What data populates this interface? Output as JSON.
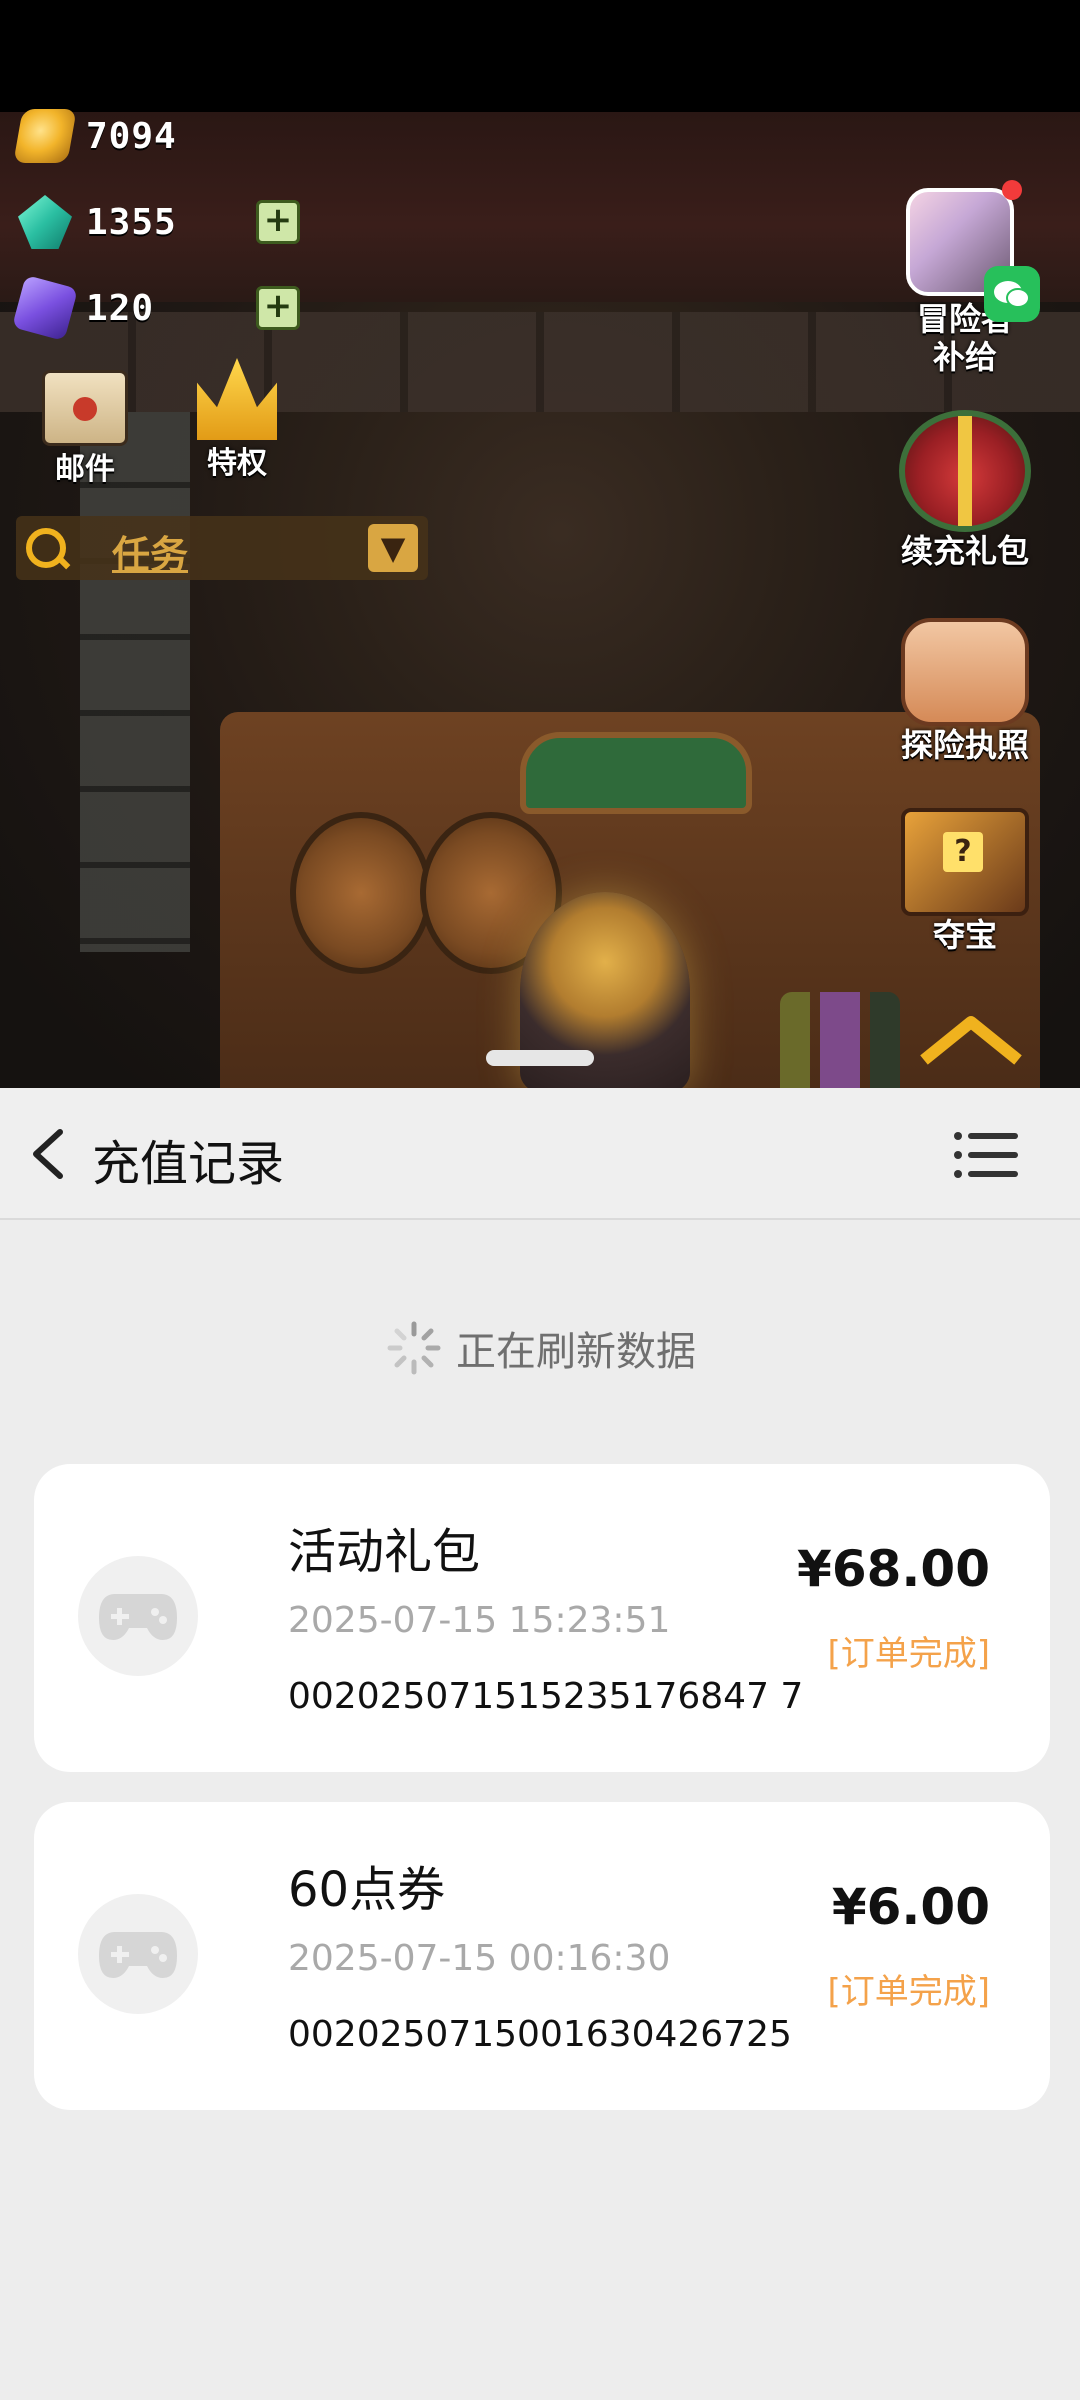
{
  "game": {
    "resources": [
      {
        "name": "gold",
        "value": "7094"
      },
      {
        "name": "diamond",
        "value": "1355"
      },
      {
        "name": "crystal",
        "value": "120"
      }
    ],
    "menu": [
      {
        "icon": "mail-icon",
        "label": "邮件"
      },
      {
        "icon": "crown-icon",
        "label": "特权"
      }
    ],
    "task_label": "任务",
    "side_buttons": [
      {
        "icon": "supply-icon",
        "label_line1": "冒险者",
        "label_line2": "补给"
      },
      {
        "icon": "gift-box-icon",
        "label": "续充礼包"
      },
      {
        "icon": "scroll-icon",
        "label": "探险执照"
      },
      {
        "icon": "treasure-icon",
        "label": "夺宝"
      }
    ]
  },
  "sheet": {
    "title": "充值记录",
    "refresh_text": "正在刷新数据",
    "records": [
      {
        "name": "活动礼包",
        "time": "2025-07-15 15:23:51",
        "order": "002025071515235176847 7",
        "price": "¥68.00",
        "status": "[订单完成]"
      },
      {
        "name": "60点券",
        "time": "2025-07-15 00:16:30",
        "order": "0020250715001630426725",
        "price": "¥6.00",
        "status": "[订单完成]"
      }
    ]
  },
  "colors": {
    "accent_orange": "#f4a24a",
    "sheet_bg": "#ededed"
  }
}
